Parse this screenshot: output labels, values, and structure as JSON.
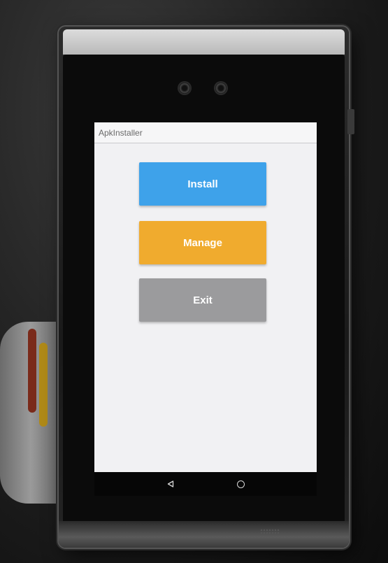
{
  "app": {
    "title": "ApkInstaller"
  },
  "buttons": [
    {
      "label": "Install",
      "color": "#3ea2ea"
    },
    {
      "label": "Manage",
      "color": "#f0ab2e"
    },
    {
      "label": "Exit",
      "color": "#9b9b9d"
    }
  ],
  "navbar": {
    "back_icon": "back-triangle-icon",
    "home_icon": "home-circle-icon"
  }
}
